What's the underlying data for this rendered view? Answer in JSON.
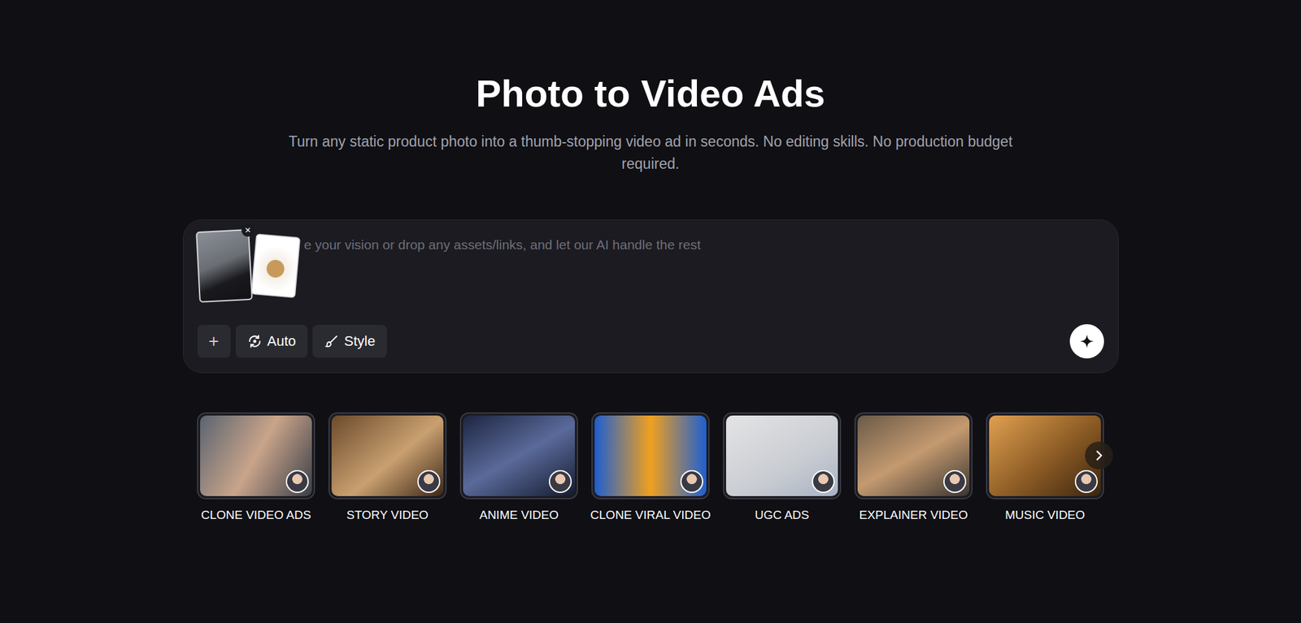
{
  "page": {
    "title": "Photo to Video Ads",
    "subtitle": "Turn any static product photo into a thumb-stopping video ad in seconds. No editing skills. No production budget required."
  },
  "prompt": {
    "placeholder": "e your vision or drop any assets/links, and let our AI handle the rest",
    "remove_label": "×",
    "attachments": [
      {
        "kind": "portrait",
        "removable": true
      },
      {
        "kind": "product",
        "removable": false
      }
    ]
  },
  "toolbar": {
    "add": "+",
    "mode": "Auto",
    "style": "Style"
  },
  "categories": [
    {
      "label": "CLONE VIDEO ADS"
    },
    {
      "label": "STORY VIDEO"
    },
    {
      "label": "ANIME VIDEO"
    },
    {
      "label": "CLONE VIRAL VIDEO"
    },
    {
      "label": "UGC ADS"
    },
    {
      "label": "EXPLAINER VIDEO"
    },
    {
      "label": "MUSIC VIDEO"
    }
  ]
}
